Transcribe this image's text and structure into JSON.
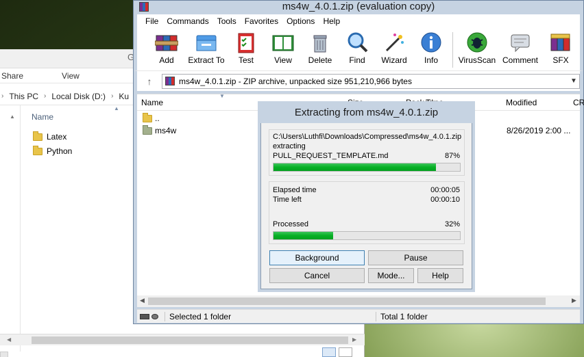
{
  "explorer": {
    "ribbon": [
      "Share",
      "View"
    ],
    "address": [
      "This PC",
      "Local Disk (D:)",
      "Ku"
    ],
    "column_name": "Name",
    "items": [
      "Latex",
      "Python"
    ]
  },
  "winrar": {
    "title": "ms4w_4.0.1.zip (evaluation copy)",
    "menu": [
      "File",
      "Commands",
      "Tools",
      "Favorites",
      "Options",
      "Help"
    ],
    "toolbar": [
      {
        "label": "Add",
        "icon": "add-archive-icon"
      },
      {
        "label": "Extract To",
        "icon": "extract-folder-icon"
      },
      {
        "label": "Test",
        "icon": "test-clipboard-icon"
      },
      {
        "label": "View",
        "icon": "book-view-icon"
      },
      {
        "label": "Delete",
        "icon": "trash-icon"
      },
      {
        "label": "Find",
        "icon": "magnifier-icon"
      },
      {
        "label": "Wizard",
        "icon": "magic-wand-icon"
      },
      {
        "label": "Info",
        "icon": "info-icon"
      },
      {
        "label": "VirusScan",
        "icon": "bug-icon"
      },
      {
        "label": "Comment",
        "icon": "comment-icon"
      },
      {
        "label": "SFX",
        "icon": "sfx-box-icon"
      }
    ],
    "path": "ms4w_4.0.1.zip - ZIP archive, unpacked size 951,210,966 bytes",
    "columns": {
      "name": "Name",
      "size": "Size",
      "packed": "Packed",
      "type": "Type",
      "modified": "Modified",
      "crc": "CR"
    },
    "rows": [
      {
        "name": "..",
        "modified": ""
      },
      {
        "name": "ms4w",
        "modified": "8/26/2019 2:00 ..."
      }
    ],
    "status_left": "Selected 1 folder",
    "status_right": "Total 1 folder"
  },
  "dialog": {
    "title": "Extracting from ms4w_4.0.1.zip",
    "archive_path": "C:\\Users\\Luthfi\\Downloads\\Compressed\\ms4w_4.0.1.zip",
    "action": "extracting",
    "current_file": "PULL_REQUEST_TEMPLATE.md",
    "file_percent": "87%",
    "file_progress": 0.87,
    "elapsed_label": "Elapsed time",
    "elapsed_value": "00:00:05",
    "left_label": "Time left",
    "left_value": "00:00:10",
    "processed_label": "Processed",
    "processed_percent": "32%",
    "processed_progress": 0.32,
    "buttons": {
      "background": "Background",
      "pause": "Pause",
      "cancel": "Cancel",
      "mode": "Mode...",
      "help": "Help"
    }
  }
}
